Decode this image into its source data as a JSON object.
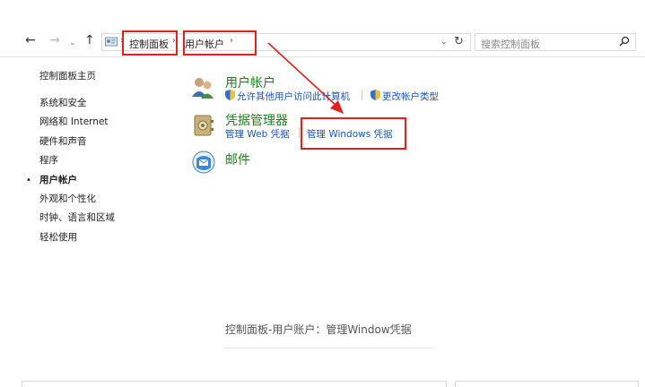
{
  "nav": {
    "back_icon": "←",
    "forward_icon": "→",
    "recent_icon": "⌄",
    "up_icon": "↑",
    "crumb_sep": "›",
    "breadcrumb": [
      "控制面板",
      "用户帐户"
    ],
    "dropdown_icon": "⌄",
    "refresh_icon": "↻",
    "search_placeholder": "搜索控制面板"
  },
  "sidebar": {
    "items": [
      {
        "label": "控制面板主页"
      },
      {
        "label": "系统和安全"
      },
      {
        "label": "网络和 Internet"
      },
      {
        "label": "硬件和声音"
      },
      {
        "label": "程序"
      },
      {
        "label": "用户帐户",
        "active": true
      },
      {
        "label": "外观和个性化"
      },
      {
        "label": "时钟、语言和区域"
      },
      {
        "label": "轻松使用"
      }
    ],
    "bullet": "•"
  },
  "categories": [
    {
      "title": "用户帐户",
      "icon": "user-accounts-icon",
      "links": [
        "允许其他用户访问此计算机",
        "更改帐户类型"
      ]
    },
    {
      "title": "凭据管理器",
      "icon": "credential-manager-icon",
      "links": [
        "管理 Web 凭据",
        "管理 Windows 凭据"
      ]
    },
    {
      "title": "邮件",
      "icon": "mail-icon",
      "links": []
    }
  ],
  "caption": "控制面板-用户账户：管理Window凭据",
  "colors": {
    "annotation_red": "#e0221f",
    "category_green": "#1e7f1e",
    "link_blue": "#1a56b8"
  }
}
